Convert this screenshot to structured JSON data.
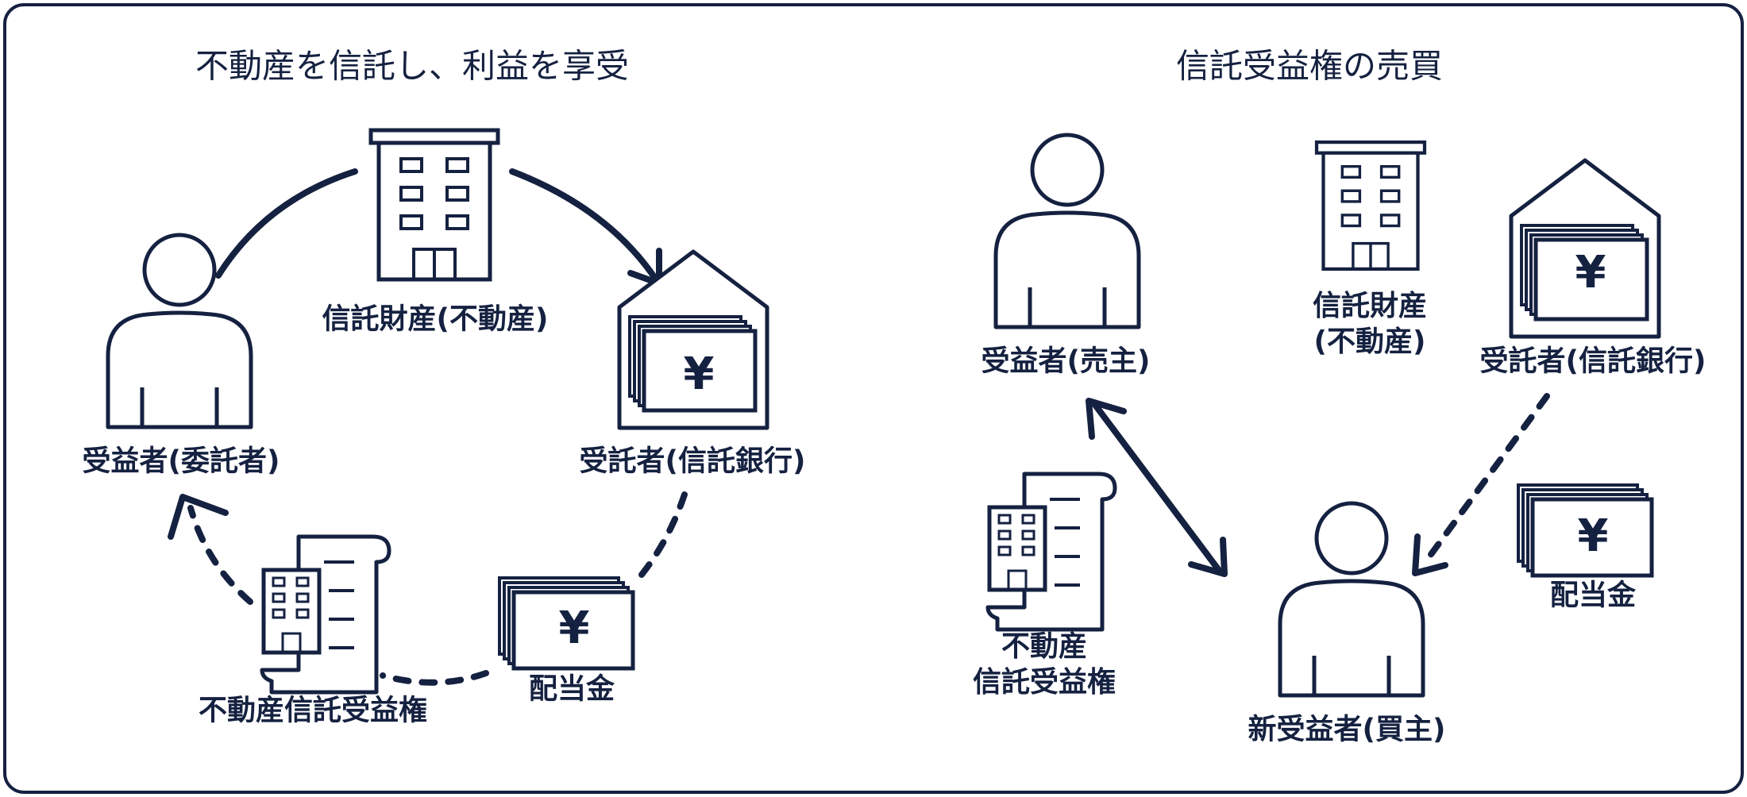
{
  "colors": {
    "ink": "#152140",
    "frame": "#152140",
    "background": "#ffffff"
  },
  "left_panel": {
    "title": "不動産を信託し、利益を享受",
    "property_label": "信託財産(不動産)",
    "beneficiary_label": "受益者(委託者)",
    "trustee_label": "受託者(信託銀行)",
    "certificate_label": "不動産信託受益権",
    "dividend_label": "配当金",
    "yen_symbol": "¥",
    "icons": [
      "building-icon",
      "person-icon",
      "bank-house-icon",
      "deed-scroll-icon",
      "banknote-stack-icon"
    ]
  },
  "right_panel": {
    "title": "信託受益権の売買",
    "seller_label": "受益者(売主)",
    "property_label_line1": "信託財産",
    "property_label_line2": "(不動産)",
    "trustee_label": "受託者(信託銀行)",
    "certificate_label_line1": "不動産",
    "certificate_label_line2": "信託受益権",
    "dividend_label": "配当金",
    "buyer_label": "新受益者(買主)",
    "yen_symbol": "¥",
    "icons": [
      "person-icon",
      "building-icon",
      "bank-house-icon",
      "deed-scroll-icon",
      "banknote-stack-icon",
      "person-icon"
    ]
  }
}
